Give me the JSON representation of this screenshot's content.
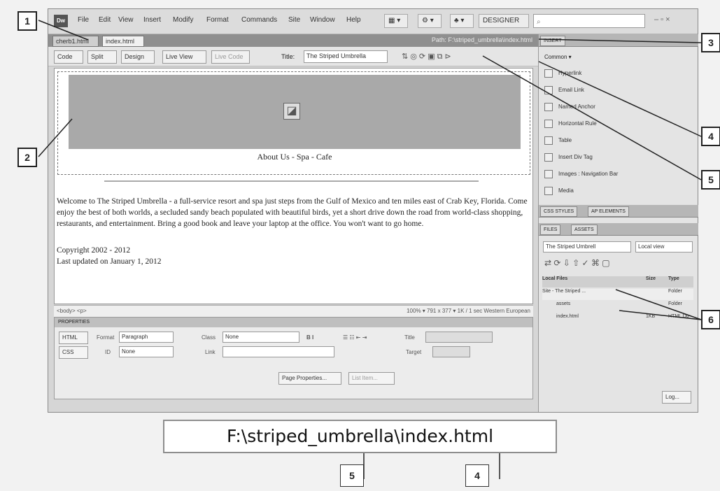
{
  "app": {
    "logo": "Dw",
    "menu": [
      "File",
      "Edit",
      "View",
      "Insert",
      "Modify",
      "Format",
      "Commands",
      "Site",
      "Window",
      "Help"
    ],
    "workspace": "DESIGNER",
    "search_placeholder": "",
    "window_controls": "– ▫ ×"
  },
  "document": {
    "tabs": [
      "cherb1.html",
      "index.html"
    ],
    "path": "Path: F:\\striped_umbrella\\index.html",
    "views": [
      "Code",
      "Split",
      "Design",
      "Live View",
      "Live Code"
    ],
    "title_label": "Title:",
    "title_value": "The Striped Umbrella",
    "banner_caption": "About Us - Spa - Cafe",
    "body_text": "Welcome to The Striped Umbrella - a full-service resort and spa just steps from the Gulf of Mexico and ten miles east of Crab Key, Florida. Come enjoy the best of both worlds, a secluded sandy beach populated with beautiful birds, yet a short drive down the road from world-class shopping, restaurants, and entertainment. Bring a good book and leave your laptop at the office. You won't want to go home.",
    "copyright": "Copyright 2002 - 2012",
    "updated": "Last updated on January 1, 2012",
    "status_left": "<body> <p>",
    "status_right": "100% ▾  791 x 377 ▾  1K / 1 sec  Western European"
  },
  "properties": {
    "header": "PROPERTIES",
    "html_label": "HTML",
    "css_label": "CSS",
    "format_label": "Format",
    "format_value": "Paragraph",
    "id_label": "ID",
    "id_value": "None",
    "class_label": "Class",
    "class_value": "None",
    "link_label": "Link",
    "title_label": "Title",
    "target_label": "Target",
    "page_properties": "Page Properties...",
    "list_item": "List Item..."
  },
  "insert_panel": {
    "tab": "INSERT",
    "category": "Common ▾",
    "items": [
      "Hyperlink",
      "Email Link",
      "Named Anchor",
      "Horizontal Rule",
      "Table",
      "Insert Div Tag",
      "Images : Navigation Bar",
      "Media"
    ]
  },
  "css_panel": {
    "tabs": [
      "CSS STYLES",
      "AP ELEMENTS"
    ]
  },
  "files_panel": {
    "tabs": [
      "FILES",
      "ASSETS"
    ],
    "site": "The Striped Umbrell",
    "view": "Local view",
    "columns": [
      "Local Files",
      "Size",
      "Type"
    ],
    "rows": [
      {
        "name": "Site - The Striped ...",
        "size": "",
        "type": "Folder"
      },
      {
        "name": "assets",
        "size": "",
        "type": "Folder"
      },
      {
        "name": "index.html",
        "size": "1KB",
        "type": "HTML Do"
      }
    ],
    "log_button": "Log..."
  },
  "callouts": [
    "1",
    "2",
    "3",
    "4",
    "5",
    "6"
  ],
  "bottom": {
    "file_path": "F:\\striped_umbrella\\index.html",
    "label_5": "5",
    "label_4": "4"
  }
}
